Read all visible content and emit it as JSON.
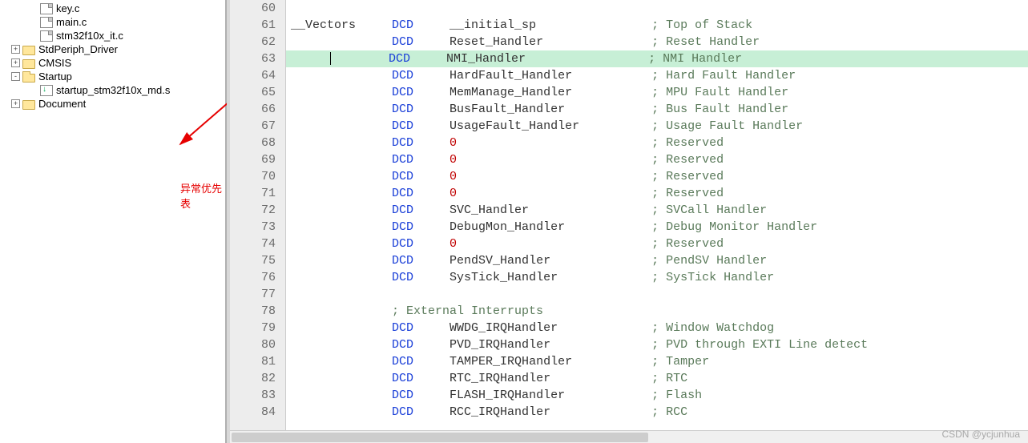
{
  "sidebar": {
    "items": [
      {
        "level": 2,
        "expander": null,
        "icon": "file",
        "label": "key.c"
      },
      {
        "level": 2,
        "expander": null,
        "icon": "file",
        "label": "main.c"
      },
      {
        "level": 2,
        "expander": null,
        "icon": "file",
        "label": "stm32f10x_it.c"
      },
      {
        "level": 1,
        "expander": "+",
        "icon": "folder",
        "label": "StdPeriph_Driver"
      },
      {
        "level": 1,
        "expander": "+",
        "icon": "folder",
        "label": "CMSIS"
      },
      {
        "level": 1,
        "expander": "-",
        "icon": "folder-open",
        "label": "Startup"
      },
      {
        "level": 2,
        "expander": null,
        "icon": "asm",
        "label": "startup_stm32f10x_md.s"
      },
      {
        "level": 1,
        "expander": "+",
        "icon": "folder",
        "label": "Document"
      }
    ]
  },
  "annotation": {
    "text": "异常优先表"
  },
  "code": {
    "highlighted_line": 63,
    "lines": [
      {
        "n": 60,
        "label": "",
        "kw": "",
        "arg": "",
        "argType": "",
        "comment": ""
      },
      {
        "n": 61,
        "label": "__Vectors",
        "kw": "DCD",
        "arg": "__initial_sp",
        "argType": "id",
        "comment": "; Top of Stack"
      },
      {
        "n": 62,
        "label": "",
        "kw": "DCD",
        "arg": "Reset_Handler",
        "argType": "id",
        "comment": "; Reset Handler"
      },
      {
        "n": 63,
        "label": "",
        "kw": "DCD",
        "arg": "NMI_Handler",
        "argType": "id",
        "comment": "; NMI Handler",
        "caret": true
      },
      {
        "n": 64,
        "label": "",
        "kw": "DCD",
        "arg": "HardFault_Handler",
        "argType": "id",
        "comment": "; Hard Fault Handler"
      },
      {
        "n": 65,
        "label": "",
        "kw": "DCD",
        "arg": "MemManage_Handler",
        "argType": "id",
        "comment": "; MPU Fault Handler"
      },
      {
        "n": 66,
        "label": "",
        "kw": "DCD",
        "arg": "BusFault_Handler",
        "argType": "id",
        "comment": "; Bus Fault Handler"
      },
      {
        "n": 67,
        "label": "",
        "kw": "DCD",
        "arg": "UsageFault_Handler",
        "argType": "id",
        "comment": "; Usage Fault Handler"
      },
      {
        "n": 68,
        "label": "",
        "kw": "DCD",
        "arg": "0",
        "argType": "num",
        "comment": "; Reserved"
      },
      {
        "n": 69,
        "label": "",
        "kw": "DCD",
        "arg": "0",
        "argType": "num",
        "comment": "; Reserved"
      },
      {
        "n": 70,
        "label": "",
        "kw": "DCD",
        "arg": "0",
        "argType": "num",
        "comment": "; Reserved"
      },
      {
        "n": 71,
        "label": "",
        "kw": "DCD",
        "arg": "0",
        "argType": "num",
        "comment": "; Reserved"
      },
      {
        "n": 72,
        "label": "",
        "kw": "DCD",
        "arg": "SVC_Handler",
        "argType": "id",
        "comment": "; SVCall Handler"
      },
      {
        "n": 73,
        "label": "",
        "kw": "DCD",
        "arg": "DebugMon_Handler",
        "argType": "id",
        "comment": "; Debug Monitor Handler"
      },
      {
        "n": 74,
        "label": "",
        "kw": "DCD",
        "arg": "0",
        "argType": "num",
        "comment": "; Reserved"
      },
      {
        "n": 75,
        "label": "",
        "kw": "DCD",
        "arg": "PendSV_Handler",
        "argType": "id",
        "comment": "; PendSV Handler"
      },
      {
        "n": 76,
        "label": "",
        "kw": "DCD",
        "arg": "SysTick_Handler",
        "argType": "id",
        "comment": "; SysTick Handler"
      },
      {
        "n": 77,
        "label": "",
        "kw": "",
        "arg": "",
        "argType": "",
        "comment": ""
      },
      {
        "n": 78,
        "label": "",
        "kw": "",
        "arg": "",
        "argType": "",
        "comment": "; External Interrupts",
        "commentCol": "kw"
      },
      {
        "n": 79,
        "label": "",
        "kw": "DCD",
        "arg": "WWDG_IRQHandler",
        "argType": "id",
        "comment": "; Window Watchdog"
      },
      {
        "n": 80,
        "label": "",
        "kw": "DCD",
        "arg": "PVD_IRQHandler",
        "argType": "id",
        "comment": "; PVD through EXTI Line detect"
      },
      {
        "n": 81,
        "label": "",
        "kw": "DCD",
        "arg": "TAMPER_IRQHandler",
        "argType": "id",
        "comment": "; Tamper"
      },
      {
        "n": 82,
        "label": "",
        "kw": "DCD",
        "arg": "RTC_IRQHandler",
        "argType": "id",
        "comment": "; RTC"
      },
      {
        "n": 83,
        "label": "",
        "kw": "DCD",
        "arg": "FLASH_IRQHandler",
        "argType": "id",
        "comment": "; Flash"
      },
      {
        "n": 84,
        "label": "",
        "kw": "DCD",
        "arg": "RCC_IRQHandler",
        "argType": "id",
        "comment": "; RCC"
      }
    ]
  },
  "watermark": "CSDN @ycjunhua"
}
